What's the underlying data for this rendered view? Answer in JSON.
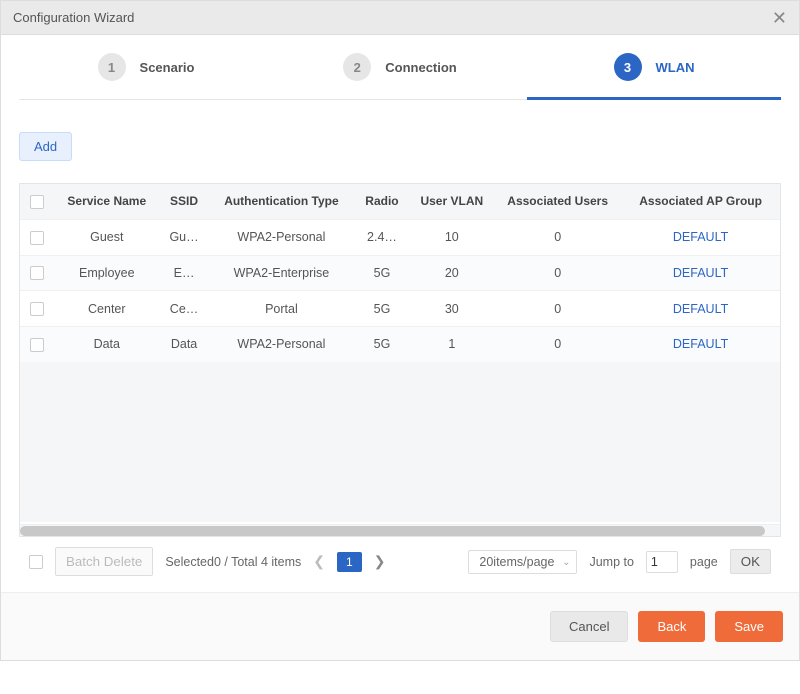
{
  "dialog": {
    "title": "Configuration Wizard"
  },
  "steps": [
    {
      "num": "1",
      "label": "Scenario"
    },
    {
      "num": "2",
      "label": "Connection"
    },
    {
      "num": "3",
      "label": "WLAN"
    }
  ],
  "toolbar": {
    "add_label": "Add"
  },
  "table": {
    "headers": {
      "service": "Service Name",
      "ssid": "SSID",
      "auth": "Authentication Type",
      "radio": "Radio",
      "vlan": "User VLAN",
      "users": "Associated Users",
      "apgroup": "Associated AP Group"
    },
    "rows": [
      {
        "service": "Guest",
        "ssid": "Gu…",
        "auth": "WPA2-Personal",
        "radio": "2.4…",
        "vlan": "10",
        "users": "0",
        "apgroup": "DEFAULT"
      },
      {
        "service": "Employee",
        "ssid": "E…",
        "auth": "WPA2-Enterprise",
        "radio": "5G",
        "vlan": "20",
        "users": "0",
        "apgroup": "DEFAULT"
      },
      {
        "service": "Center",
        "ssid": "Ce…",
        "auth": "Portal",
        "radio": "5G",
        "vlan": "30",
        "users": "0",
        "apgroup": "DEFAULT"
      },
      {
        "service": "Data",
        "ssid": "Data",
        "auth": "WPA2-Personal",
        "radio": "5G",
        "vlan": "1",
        "users": "0",
        "apgroup": "DEFAULT"
      }
    ]
  },
  "pager": {
    "batch_delete": "Batch Delete",
    "summary": "Selected0 / Total 4 items",
    "current_page": "1",
    "per_page": "20items/page",
    "jump_label": "Jump to",
    "jump_value": "1",
    "page_label": "page",
    "ok": "OK"
  },
  "footer": {
    "cancel": "Cancel",
    "back": "Back",
    "save": "Save"
  }
}
